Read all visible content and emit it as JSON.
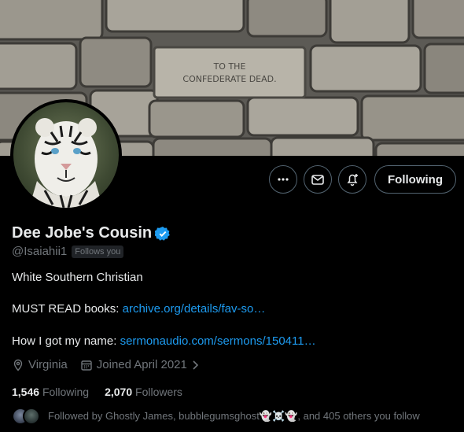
{
  "banner": {
    "inscription_line1": "TO THE",
    "inscription_line2": "CONFEDERATE DEAD."
  },
  "actions": {
    "following_label": "Following"
  },
  "profile": {
    "display_name": "Dee Jobe's Cousin",
    "handle": "@Isaiahii1",
    "follows_you": "Follows you",
    "bio_line1": "White Southern Christian",
    "bio_line2_prefix": "MUST READ books: ",
    "bio_line2_link": "archive.org/details/fav-so…",
    "bio_line3_prefix": "How I got my name: ",
    "bio_line3_link": "sermonaudio.com/sermons/150411…",
    "location": "Virginia",
    "joined": "Joined April 2021"
  },
  "stats": {
    "following_count": "1,546",
    "following_label": "Following",
    "followers_count": "2,070",
    "followers_label": "Followers"
  },
  "followed_by": {
    "text": "Followed by Ghostly James, bubblegumsghost👻☠️👻, and 405 others you follow"
  },
  "colors": {
    "accent": "#1d9bf0",
    "muted": "#71767b",
    "verified": "#1d9bf0"
  }
}
